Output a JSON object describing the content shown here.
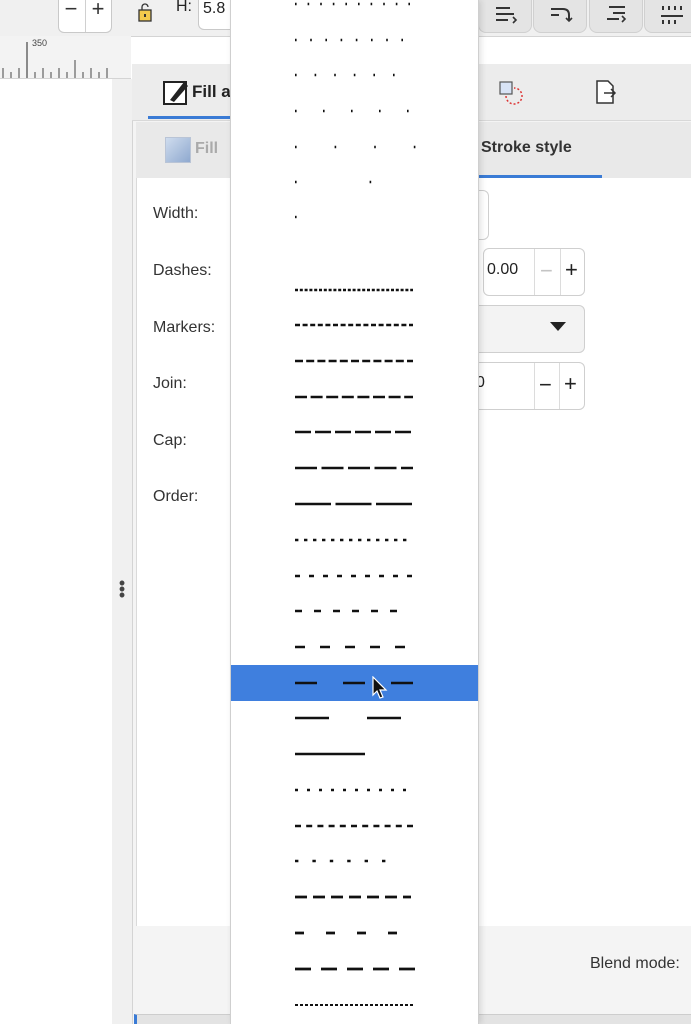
{
  "toolbar": {
    "minus_symbol": "−",
    "plus_symbol": "+",
    "h_label": "H:",
    "h_value": "5.8",
    "icons": [
      "lock-icon",
      "align-icon",
      "align-curve-icon",
      "align-right-icon",
      "distribute-icon"
    ]
  },
  "ruler": {
    "label": "350"
  },
  "dock": {
    "tabs": [
      {
        "label": "Fill a",
        "icon": "fill-stroke-icon",
        "active": true
      },
      {
        "label": "",
        "icon": "transform-icon"
      },
      {
        "label": "",
        "icon": "export-icon"
      }
    ],
    "subtabs": {
      "fill_label": "Fill",
      "stroke_style_label": "Stroke style"
    },
    "fields": {
      "width_label": "Width:",
      "dashes_label": "Dashes:",
      "markers_label": "Markers:",
      "join_label": "Join:",
      "cap_label": "Cap:",
      "order_label": "Order:"
    },
    "dash_offset_value": "0.00",
    "miter_value": "0",
    "minus_symbol": "−",
    "plus_symbol": "+",
    "blend_mode_label": "Blend mode:"
  },
  "dash_popup": {
    "selected_index": 18,
    "accent_color": "#3f7fde",
    "item_count": 28
  }
}
